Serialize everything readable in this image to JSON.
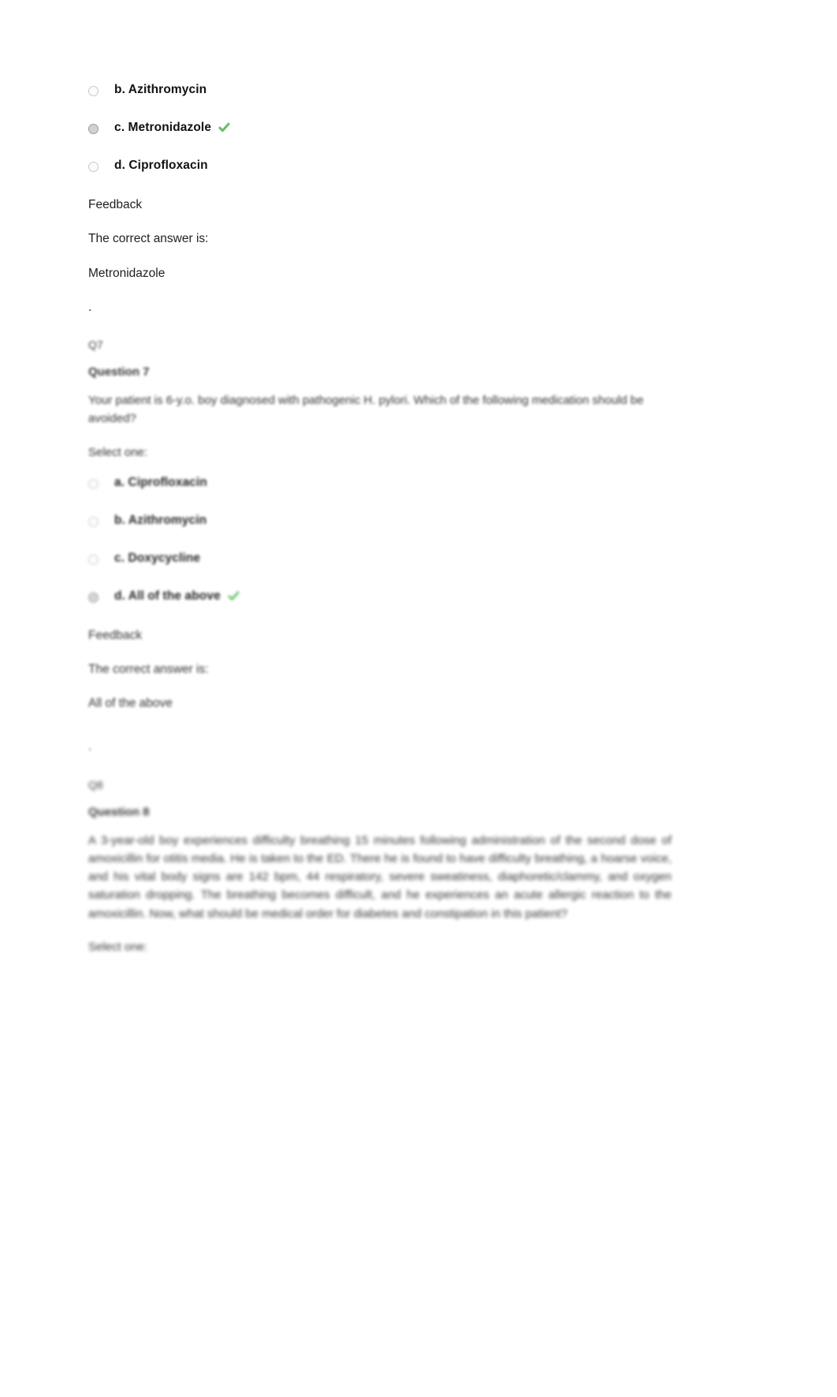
{
  "document": {
    "type": "quiz-review",
    "background_color": "#ffffff",
    "text_color": "#1a1a1a",
    "correct_mark_color": "#6cc06c"
  },
  "question6": {
    "options": [
      {
        "letter_label": "b. Azithromycin",
        "selected": false,
        "correct": false
      },
      {
        "letter_label": "c. Metronidazole",
        "selected": true,
        "correct": true
      },
      {
        "letter_label": "d. Ciprofloxacin",
        "selected": false,
        "correct": false
      }
    ],
    "feedback_heading": "Feedback",
    "correct_answer_intro": "The correct answer is:",
    "correct_answer_text": "Metronidazole",
    "trailing_dot": "."
  },
  "question7": {
    "question_number_label": "Q7",
    "heading": "Question 7",
    "stem": "Your patient is 6-y.o. boy diagnosed with pathogenic H. pylori. Which of the following medication should be avoided?",
    "select_one_label": "Select one:",
    "options": [
      {
        "letter_label": "a. Ciprofloxacin",
        "selected": false,
        "correct": false
      },
      {
        "letter_label": "b. Azithromycin",
        "selected": false,
        "correct": false
      },
      {
        "letter_label": "c. Doxycycline",
        "selected": false,
        "correct": false
      },
      {
        "letter_label": "d. All of the above",
        "selected": true,
        "correct": true
      }
    ],
    "feedback_heading": "Feedback",
    "correct_answer_intro": "The correct answer is:",
    "correct_answer_text": "All of the above",
    "trailing_dot": "."
  },
  "question8": {
    "question_number_label": "Q8",
    "heading": "Question 8",
    "stem": "A 3-year-old boy experiences difficulty breathing 15 minutes following administration of the second dose of amoxicillin for otitis media. He is taken to the ED. There he is found to have difficulty breathing, a hoarse voice, and his vital body signs are 142 bpm, 44 respiratory, severe sweatiness, diaphoretic/clammy, and oxygen saturation dropping. The breathing becomes difficult, and he experiences an acute allergic reaction to the amoxicillin. Now, what should be medical order for diabetes and constipation in this patient?",
    "select_one_label": "Select one:"
  }
}
